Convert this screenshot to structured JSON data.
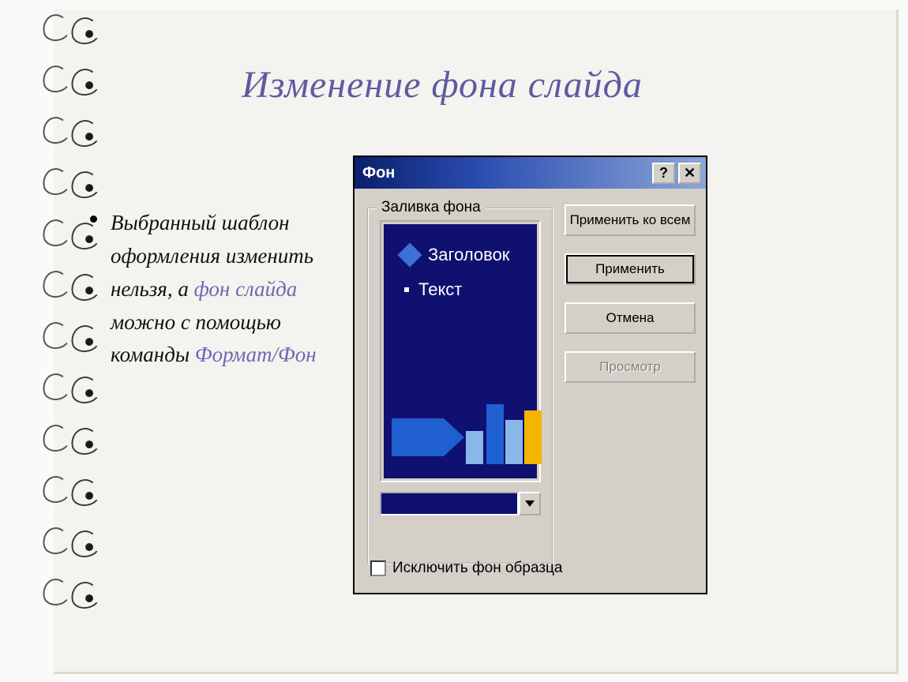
{
  "slide": {
    "title": "Изменение фона слайда",
    "body": {
      "part1": "Выбранный шаблон оформления изменить нельзя, а ",
      "accent1": "фон слайда",
      "part2": " можно с помощью команды ",
      "accent2": "Формат/Фон"
    }
  },
  "dialog": {
    "title": "Фон",
    "help_symbol": "?",
    "close_symbol": "✕",
    "groupbox_label": "Заливка фона",
    "preview": {
      "heading": "Заголовок",
      "text": "Текст"
    },
    "checkbox_label": "Исключить фон образца",
    "buttons": {
      "apply_all": "Применить ко всем",
      "apply": "Применить",
      "cancel": "Отмена",
      "preview": "Просмотр"
    }
  }
}
